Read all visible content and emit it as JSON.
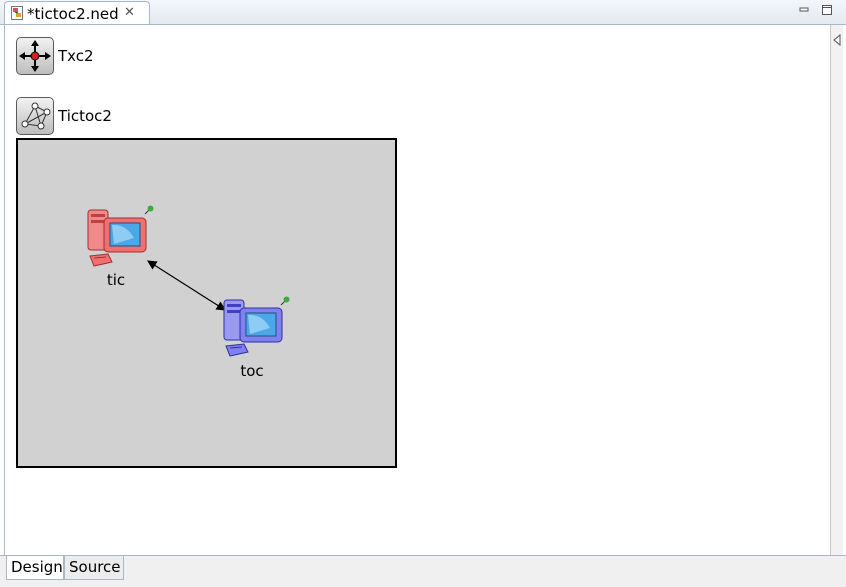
{
  "editor_tab": {
    "title": "*tictoc2.ned",
    "close_glyph": "✕",
    "icon": "ned-file-icon"
  },
  "window_controls": {
    "minimize": "minimize-icon",
    "maximize": "maximize-icon"
  },
  "types": [
    {
      "name": "Txc2",
      "icon": "simple-module-icon"
    },
    {
      "name": "Tictoc2",
      "icon": "compound-module-icon"
    }
  ],
  "network": {
    "nodes": [
      {
        "name": "tic",
        "icon": "computer-red-icon",
        "color": "#e86a6a"
      },
      {
        "name": "toc",
        "icon": "computer-blue-icon",
        "color": "#7a7ae8"
      }
    ],
    "connection": "bidirectional-arrow"
  },
  "page_tabs": {
    "design": "Design",
    "source": "Source",
    "active": "Design"
  }
}
